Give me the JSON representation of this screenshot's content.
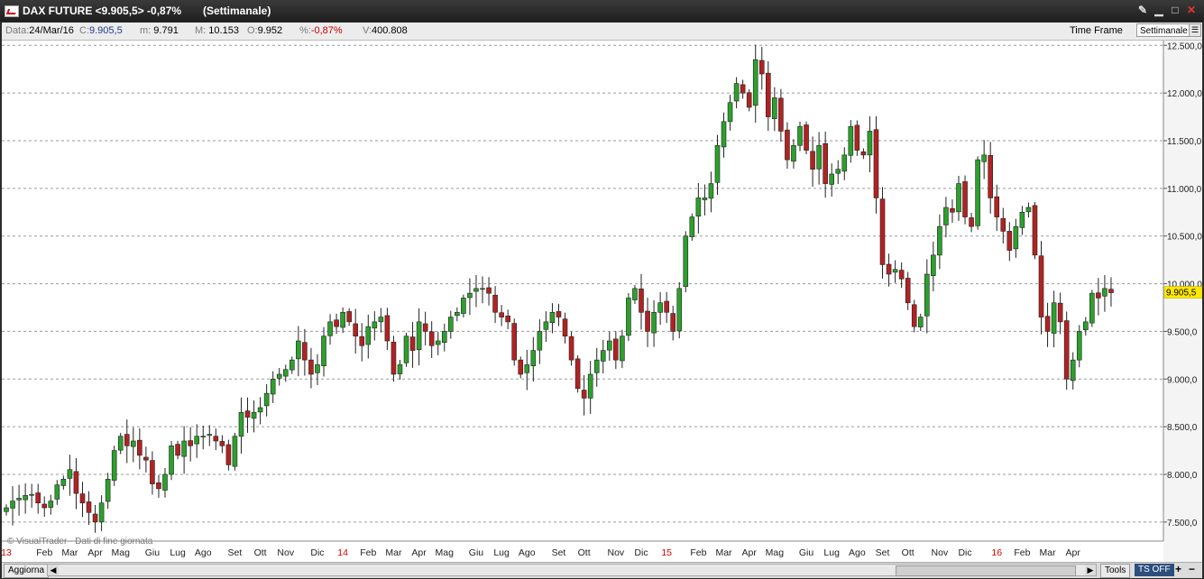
{
  "window": {
    "title": "DAX FUTURE <9.905,5> -0,87%",
    "timeframe_title": "(Settimanale)",
    "buttons": [
      "pin",
      "minimize",
      "maximize",
      "close"
    ]
  },
  "infobar": {
    "data_label": "Data:",
    "data_value": "24/Mar/16",
    "c_label": "C:",
    "c_value": "9.905,5",
    "m_label": "m:",
    "m_value": "9.791",
    "M_label": "M:",
    "M_value": "10.153",
    "o_label": "O:",
    "o_value": "9.952",
    "pct_label": "%:",
    "pct_value": "-0,87%",
    "v_label": "V:",
    "v_value": "400.808",
    "timeframe_label": "Time Frame",
    "timeframe_value": "Settimanale"
  },
  "watermark": "© VisualTrader - Dati di fine giornata",
  "bottombar": {
    "refresh_label": "Aggiorna",
    "tools_label": "Tools",
    "ts_label": "TS OFF",
    "zoom_in": "+",
    "zoom_out": "−"
  },
  "colors": {
    "up": "#2ca02c",
    "down": "#b22222",
    "price_tag": "#ffe800"
  },
  "chart_data": {
    "type": "candlestick",
    "title": "DAX FUTURE",
    "ylim": [
      7300,
      12550
    ],
    "y_ticks": [
      7500,
      8000,
      8500,
      9000,
      9500,
      10000,
      10500,
      11000,
      11500,
      12000,
      12500
    ],
    "y_tick_labels": [
      "7.500,0",
      "8.000,0",
      "8.500,0",
      "9.000,0",
      "9.500,0",
      "10.000,0",
      "10.500,0",
      "11.000,0",
      "11.500,0",
      "12.000,0",
      "12.500,0"
    ],
    "last_price_label": "9.905,5",
    "last_price": 9905.5,
    "x_labels": [
      {
        "label": "13",
        "week": 0,
        "year": true
      },
      {
        "label": "Feb",
        "week": 6
      },
      {
        "label": "Mar",
        "week": 10
      },
      {
        "label": "Apr",
        "week": 14
      },
      {
        "label": "Mag",
        "week": 18
      },
      {
        "label": "Giu",
        "week": 23
      },
      {
        "label": "Lug",
        "week": 27
      },
      {
        "label": "Ago",
        "week": 31
      },
      {
        "label": "Set",
        "week": 36
      },
      {
        "label": "Ott",
        "week": 40
      },
      {
        "label": "Nov",
        "week": 44
      },
      {
        "label": "Dic",
        "week": 49
      },
      {
        "label": "14",
        "week": 53,
        "year": true
      },
      {
        "label": "Feb",
        "week": 57
      },
      {
        "label": "Mar",
        "week": 61
      },
      {
        "label": "Apr",
        "week": 65
      },
      {
        "label": "Mag",
        "week": 69
      },
      {
        "label": "Giu",
        "week": 74
      },
      {
        "label": "Lug",
        "week": 78
      },
      {
        "label": "Ago",
        "week": 82
      },
      {
        "label": "Set",
        "week": 87
      },
      {
        "label": "Ott",
        "week": 91
      },
      {
        "label": "Nov",
        "week": 96
      },
      {
        "label": "Dic",
        "week": 100
      },
      {
        "label": "15",
        "week": 104,
        "year": true
      },
      {
        "label": "Feb",
        "week": 109
      },
      {
        "label": "Mar",
        "week": 113
      },
      {
        "label": "Apr",
        "week": 117
      },
      {
        "label": "Mag",
        "week": 121
      },
      {
        "label": "Giu",
        "week": 126
      },
      {
        "label": "Lug",
        "week": 130
      },
      {
        "label": "Ago",
        "week": 134
      },
      {
        "label": "Set",
        "week": 138
      },
      {
        "label": "Ott",
        "week": 142
      },
      {
        "label": "Nov",
        "week": 147
      },
      {
        "label": "Dic",
        "week": 151
      },
      {
        "label": "16",
        "week": 156,
        "year": true
      },
      {
        "label": "Feb",
        "week": 160
      },
      {
        "label": "Mar",
        "week": 164
      },
      {
        "label": "Apr",
        "week": 168
      }
    ],
    "weekly_close": [
      7650,
      7720,
      7750,
      7780,
      7790,
      7700,
      7650,
      7720,
      7890,
      7950,
      8050,
      7800,
      7700,
      7600,
      7500,
      7700,
      7950,
      8250,
      8400,
      8300,
      8350,
      8200,
      8150,
      7900,
      7850,
      8000,
      8300,
      8200,
      8350,
      8300,
      8400,
      8400,
      8420,
      8350,
      8300,
      8100,
      8400,
      8650,
      8600,
      8650,
      8700,
      8850,
      9000,
      9050,
      9100,
      9200,
      9400,
      9200,
      9050,
      9150,
      9450,
      9600,
      9550,
      9700,
      9600,
      9450,
      9350,
      9550,
      9600,
      9650,
      9400,
      9050,
      9150,
      9450,
      9300,
      9600,
      9500,
      9350,
      9400,
      9500,
      9650,
      9700,
      9850,
      9900,
      9950,
      9950,
      9900,
      9700,
      9650,
      9600,
      9200,
      9050,
      9150,
      9300,
      9500,
      9600,
      9700,
      9650,
      9450,
      9200,
      8900,
      8800,
      9050,
      9200,
      9300,
      9400,
      9200,
      9450,
      9850,
      9950,
      9700,
      9500,
      9700,
      9800,
      9700,
      9500,
      9950,
      10500,
      10700,
      10900,
      10900,
      11050,
      11450,
      11700,
      11900,
      12100,
      12000,
      11850,
      12350,
      12200,
      11750,
      11950,
      11600,
      11300,
      11450,
      11650,
      11400,
      11200,
      11450,
      11050,
      11150,
      11200,
      11350,
      11650,
      11400,
      11350,
      11600,
      10900,
      10200,
      10100,
      10150,
      10050,
      9800,
      9550,
      9650,
      10100,
      10300,
      10600,
      10800,
      10750,
      11050,
      10700,
      10600,
      11300,
      11350,
      10900,
      10700,
      10550,
      10350,
      10600,
      10750,
      10800,
      10300,
      9650,
      9500,
      9800,
      9600,
      9000,
      9200,
      9500,
      9600,
      9900,
      9850,
      9950,
      9905.5
    ]
  }
}
